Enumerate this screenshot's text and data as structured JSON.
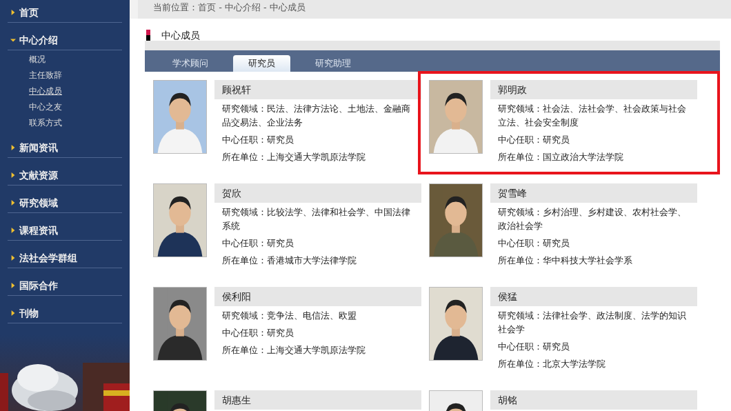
{
  "sidebar": {
    "items": [
      {
        "label": "首页",
        "expanded": false
      },
      {
        "label": "中心介绍",
        "expanded": true,
        "children": [
          {
            "label": "概况",
            "selected": false
          },
          {
            "label": "主任致辞",
            "selected": false
          },
          {
            "label": "中心成员",
            "selected": true
          },
          {
            "label": "中心之友",
            "selected": false
          },
          {
            "label": "联系方式",
            "selected": false
          }
        ]
      },
      {
        "label": "新闻资讯",
        "expanded": false
      },
      {
        "label": "文献资源",
        "expanded": false
      },
      {
        "label": "研究领域",
        "expanded": false
      },
      {
        "label": "课程资讯",
        "expanded": false
      },
      {
        "label": "法社会学群组",
        "expanded": false
      },
      {
        "label": "国际合作",
        "expanded": false
      },
      {
        "label": "刊物",
        "expanded": false
      }
    ]
  },
  "breadcrumb": "当前位置：首页 - 中心介绍 - 中心成员",
  "section_title": "中心成员",
  "tabs": [
    {
      "label": "学术顾问",
      "selected": false
    },
    {
      "label": "研究员",
      "selected": true
    },
    {
      "label": "研究助理",
      "selected": false
    }
  ],
  "members": [
    {
      "name": "顾祝轩",
      "highlighted": false,
      "lines": [
        "研究领域：民法、法律方法论、土地法、金融商品交易法、企业法务",
        "中心任职：研究员",
        "所在单位：上海交通大学凯原法学院"
      ]
    },
    {
      "name": "郭明政",
      "highlighted": true,
      "lines": [
        "研究领域：社会法、法社会学、社会政策与社会立法、社会安全制度",
        "中心任职：研究员",
        "所在单位：国立政治大学法学院"
      ]
    },
    {
      "name": "贺欣",
      "highlighted": false,
      "lines": [
        "研究领域：比较法学、法律和社会学、中国法律系统",
        "中心任职：研究员",
        "所在单位：香港城市大学法律学院"
      ]
    },
    {
      "name": "贺雪峰",
      "highlighted": false,
      "lines": [
        "研究领域：乡村治理、乡村建设、农村社会学、政治社会学",
        "中心任职：研究员",
        "所在单位：华中科技大学社会学系"
      ]
    },
    {
      "name": "侯利阳",
      "highlighted": false,
      "lines": [
        "研究领域：竞争法、电信法、欧盟",
        "中心任职：研究员",
        "所在单位：上海交通大学凯原法学院"
      ]
    },
    {
      "name": "侯猛",
      "highlighted": false,
      "lines": [
        "研究领域：法律社会学、政法制度、法学的知识社会学",
        "中心任职：研究员",
        "所在单位：北京大学法学院"
      ]
    },
    {
      "name": "胡惠生",
      "highlighted": false
    },
    {
      "name": "胡铭",
      "highlighted": false
    }
  ]
}
